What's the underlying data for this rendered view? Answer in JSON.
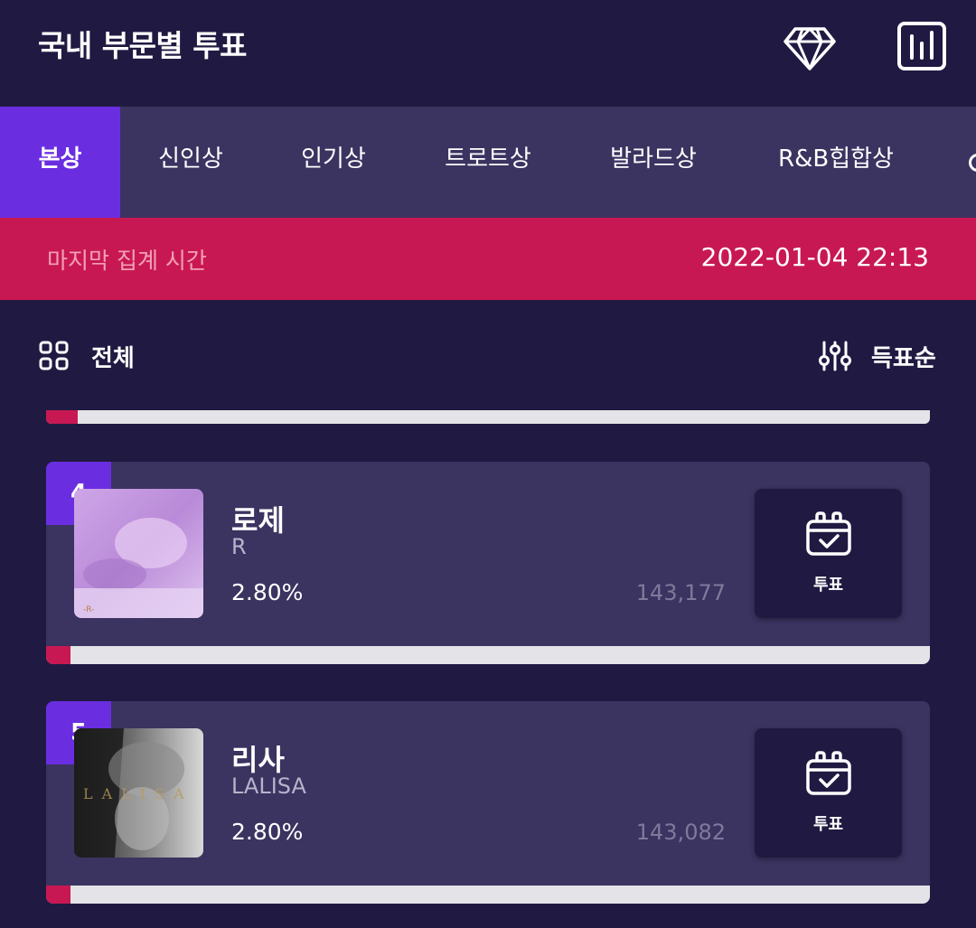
{
  "header": {
    "title": "국내 부문별 투표",
    "icons": [
      "diamond-icon",
      "stats-icon"
    ]
  },
  "tabs": [
    {
      "label": "본상",
      "active": true
    },
    {
      "label": "신인상",
      "active": false
    },
    {
      "label": "인기상",
      "active": false
    },
    {
      "label": "트로트상",
      "active": false
    },
    {
      "label": "발라드상",
      "active": false
    },
    {
      "label": "R&B힙합상",
      "active": false
    }
  ],
  "banner": {
    "label": "마지막 집계 시간",
    "time": "2022-01-04 22:13"
  },
  "filter": {
    "category_label": "전체",
    "sort_label": "득표순"
  },
  "entries": [
    {
      "rank": "4",
      "artist": "로제",
      "album": "R",
      "percent": "2.80%",
      "votes": "143,177",
      "vote_label": "투표",
      "progress": 0.028
    },
    {
      "rank": "5",
      "artist": "리사",
      "album": "LALISA",
      "percent": "2.80%",
      "votes": "143,082",
      "vote_label": "투표",
      "progress": 0.028
    }
  ],
  "colors": {
    "background": "#201a42",
    "panel": "#3b3360",
    "accent_purple": "#6a2ee0",
    "accent_red": "#c81853",
    "bar_track": "#e4e4e8"
  }
}
